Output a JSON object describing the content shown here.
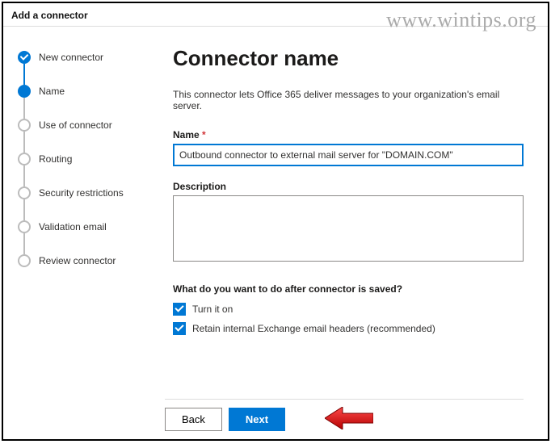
{
  "watermark": "www.wintips.org",
  "header": {
    "title": "Add a connector"
  },
  "sidebar": {
    "steps": [
      {
        "label": "New connector"
      },
      {
        "label": "Name"
      },
      {
        "label": "Use of connector"
      },
      {
        "label": "Routing"
      },
      {
        "label": "Security restrictions"
      },
      {
        "label": "Validation email"
      },
      {
        "label": "Review connector"
      }
    ]
  },
  "main": {
    "title": "Connector name",
    "subtitle": "This connector lets Office 365 deliver messages to your organization's email server.",
    "name_label": "Name",
    "name_value": "Outbound connector to external mail server for \"DOMAIN.COM\"",
    "description_label": "Description",
    "description_value": "",
    "after_save_question": "What do you want to do after connector is saved?",
    "checkbox1_label": "Turn it on",
    "checkbox1_checked": true,
    "checkbox2_label": "Retain internal Exchange email headers (recommended)",
    "checkbox2_checked": true
  },
  "footer": {
    "back_label": "Back",
    "next_label": "Next"
  }
}
